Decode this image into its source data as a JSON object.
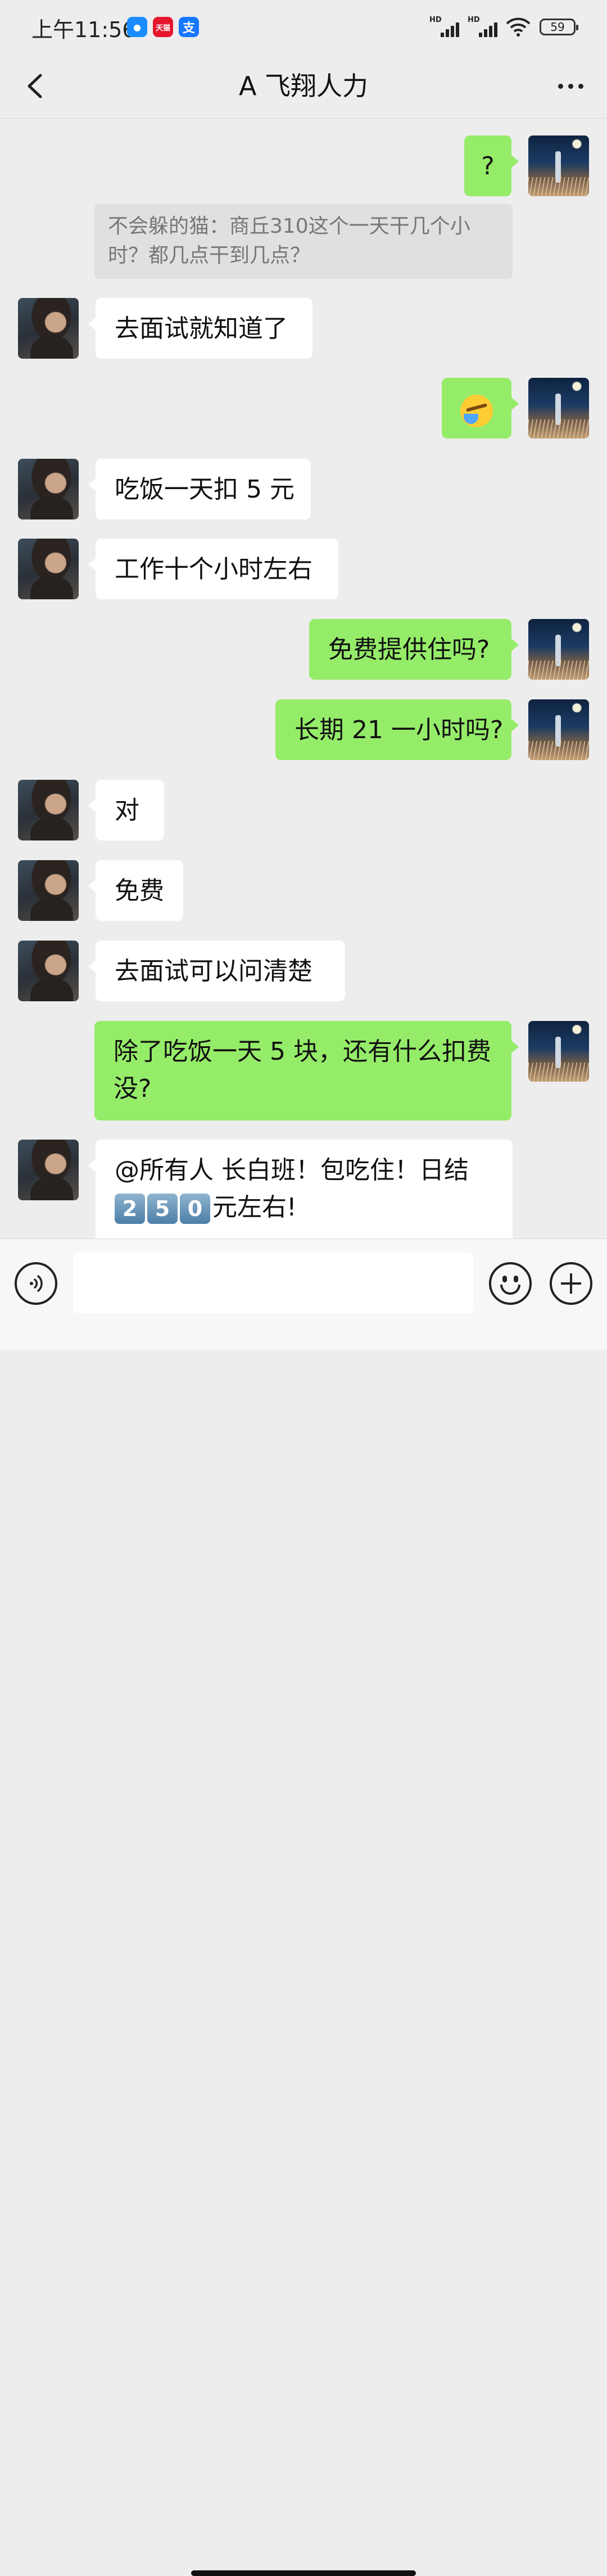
{
  "status_bar": {
    "time": "上午11:56",
    "apps": [
      {
        "name": "qq-icon",
        "label": "",
        "color": "#1a8cff"
      },
      {
        "name": "tmall-icon",
        "label": "天猫",
        "color": "#e6162d"
      },
      {
        "name": "alipay-icon",
        "label": "支",
        "color": "#1677ff"
      }
    ],
    "signal_label": "HD",
    "battery": "59"
  },
  "header": {
    "title": "A 飞翔人力"
  },
  "quote": {
    "text": "不会躲的猫：商丘310这个一天干几个小时？都几点干到几点？"
  },
  "messages": {
    "m1": "?",
    "m2": "去面试就知道了",
    "m4": "吃饭一天扣 5 元",
    "m5": "工作十个小时左右",
    "m6": "免费提供住吗?",
    "m7": "长期 21 一小时吗?",
    "m8": "对",
    "m9": "免费",
    "m10": "去面试可以问清楚",
    "m11": "除了吃饭一天 5 块，还有什么扣费没?",
    "m12_line1": "@所有人 长白班！包吃住！日结",
    "m12_digits": [
      "2",
      "5",
      "0"
    ],
    "m12_tail": "元左右!"
  },
  "input": {
    "placeholder": ""
  },
  "colors": {
    "self_bubble": "#95ec69",
    "other_bubble": "#ffffff",
    "background": "#ededed"
  }
}
